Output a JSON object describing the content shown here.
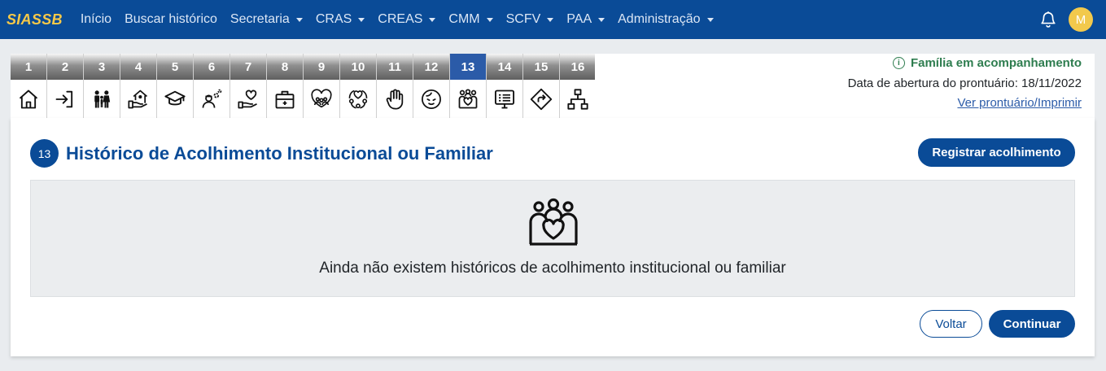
{
  "navbar": {
    "brand": "SIASSB",
    "items": [
      {
        "label": "Início",
        "dropdown": false
      },
      {
        "label": "Buscar histórico",
        "dropdown": false
      },
      {
        "label": "Secretaria",
        "dropdown": true
      },
      {
        "label": "CRAS",
        "dropdown": true
      },
      {
        "label": "CREAS",
        "dropdown": true
      },
      {
        "label": "CMM",
        "dropdown": true
      },
      {
        "label": "SCFV",
        "dropdown": true
      },
      {
        "label": "PAA",
        "dropdown": true
      },
      {
        "label": "Administração",
        "dropdown": true
      }
    ],
    "avatar_initial": "M",
    "icons": {
      "notifications": "bell-icon"
    }
  },
  "steps": {
    "active": "13",
    "items": [
      {
        "num": "1",
        "icon": "home-icon"
      },
      {
        "num": "2",
        "icon": "sign-in-icon"
      },
      {
        "num": "3",
        "icon": "family-icon"
      },
      {
        "num": "4",
        "icon": "house-hand-icon"
      },
      {
        "num": "5",
        "icon": "graduation-cap-icon"
      },
      {
        "num": "6",
        "icon": "worker-gears-icon"
      },
      {
        "num": "7",
        "icon": "heart-hand-icon"
      },
      {
        "num": "8",
        "icon": "medical-kit-icon"
      },
      {
        "num": "9",
        "icon": "group-heart-icon"
      },
      {
        "num": "10",
        "icon": "people-cycle-icon"
      },
      {
        "num": "11",
        "icon": "hand-stop-icon"
      },
      {
        "num": "12",
        "icon": "face-icon"
      },
      {
        "num": "13",
        "icon": "family-heart-icon"
      },
      {
        "num": "14",
        "icon": "screen-list-icon"
      },
      {
        "num": "15",
        "icon": "direction-sign-icon"
      },
      {
        "num": "16",
        "icon": "hierarchy-icon"
      }
    ]
  },
  "header_info": {
    "family_status": "Família em acompanhamento",
    "open_date": "Data de abertura do prontuário: 18/11/2022",
    "view_link": "Ver prontuário/Imprimir"
  },
  "section": {
    "badge": "13",
    "title": "Histórico de Acolhimento Institucional ou Familiar",
    "register_button": "Registrar acolhimento",
    "empty_message": "Ainda não existem históricos de acolhimento institucional ou familiar",
    "back_button": "Voltar",
    "continue_button": "Continuar"
  },
  "colors": {
    "primary": "#0a4b97",
    "brand": "#f7c948",
    "status_green": "#2e7d4f",
    "active_step": "#2b5ba8"
  }
}
